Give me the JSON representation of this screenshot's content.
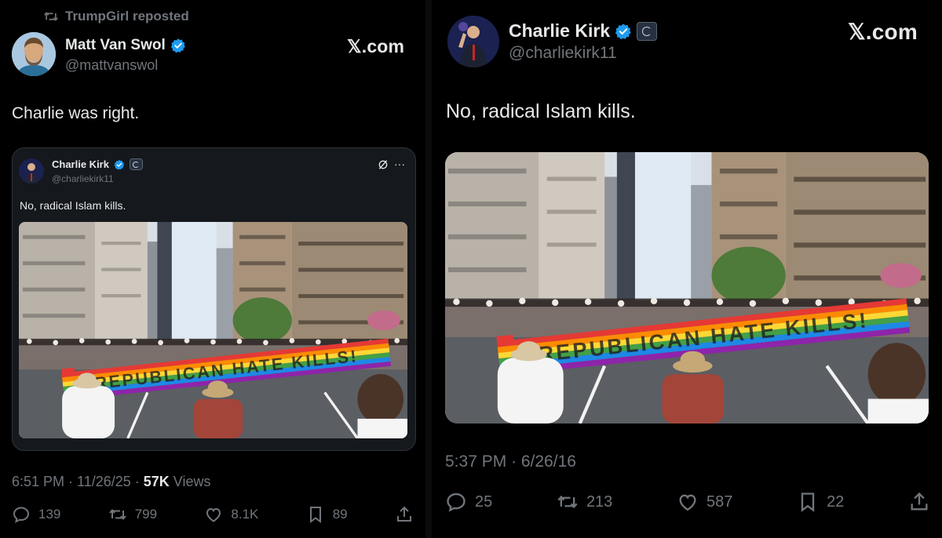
{
  "left": {
    "repost_label": "TrumpGirl reposted",
    "author": {
      "name": "Matt Van Swol",
      "handle": "@mattvanswol"
    },
    "site": "𝕏.com",
    "text": "Charlie was right.",
    "quote": {
      "author": {
        "name": "Charlie Kirk",
        "handle": "@charliekirk11"
      },
      "text": "No, radical Islam kills.",
      "more": "···"
    },
    "meta": {
      "time_date": "6:51 PM · 11/26/25 · ",
      "views_count": "57K",
      "views_label": " Views"
    },
    "actions": {
      "replies": "139",
      "reposts": "799",
      "likes": "8.1K",
      "bookmarks": "89"
    }
  },
  "right": {
    "author": {
      "name": "Charlie Kirk",
      "handle": "@charliekirk11"
    },
    "site": "𝕏.com",
    "text": "No, radical Islam kills.",
    "meta": {
      "time_date": "5:37 PM · 6/26/16"
    },
    "actions": {
      "replies": "25",
      "reposts": "213",
      "likes": "587",
      "bookmarks": "22"
    }
  },
  "image": {
    "banner_text": "REPUBLICAN HATE KILLS!"
  },
  "colors": {
    "background": "#000000",
    "text": "#e7e9ea",
    "muted": "#71767b",
    "verified": "#1d9bf0",
    "quote_bg": "#15181c"
  }
}
